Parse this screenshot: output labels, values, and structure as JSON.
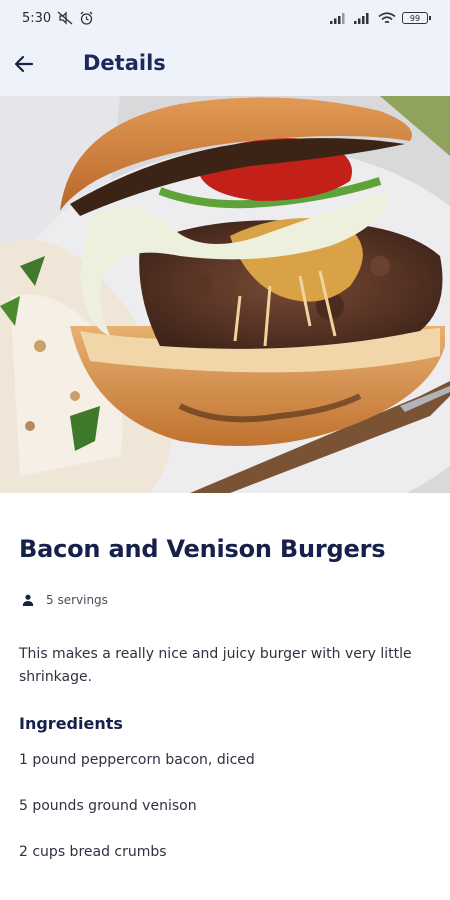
{
  "status_bar": {
    "time": "5:30",
    "battery": "99"
  },
  "app_bar": {
    "title": "Details",
    "back_icon": "arrow-left-icon"
  },
  "recipe": {
    "title": "Bacon and Venison Burgers",
    "servings": "5 servings",
    "description": "This makes a really nice and juicy burger with very little shrinkage.",
    "ingredients_heading": "Ingredients",
    "ingredients": [
      "1 pound peppercorn bacon, diced",
      "5 pounds ground venison",
      "2 cups bread crumbs"
    ]
  },
  "colors": {
    "header_bg": "#eef2fb",
    "title_text": "#16204a",
    "body_text": "#2e3240"
  }
}
